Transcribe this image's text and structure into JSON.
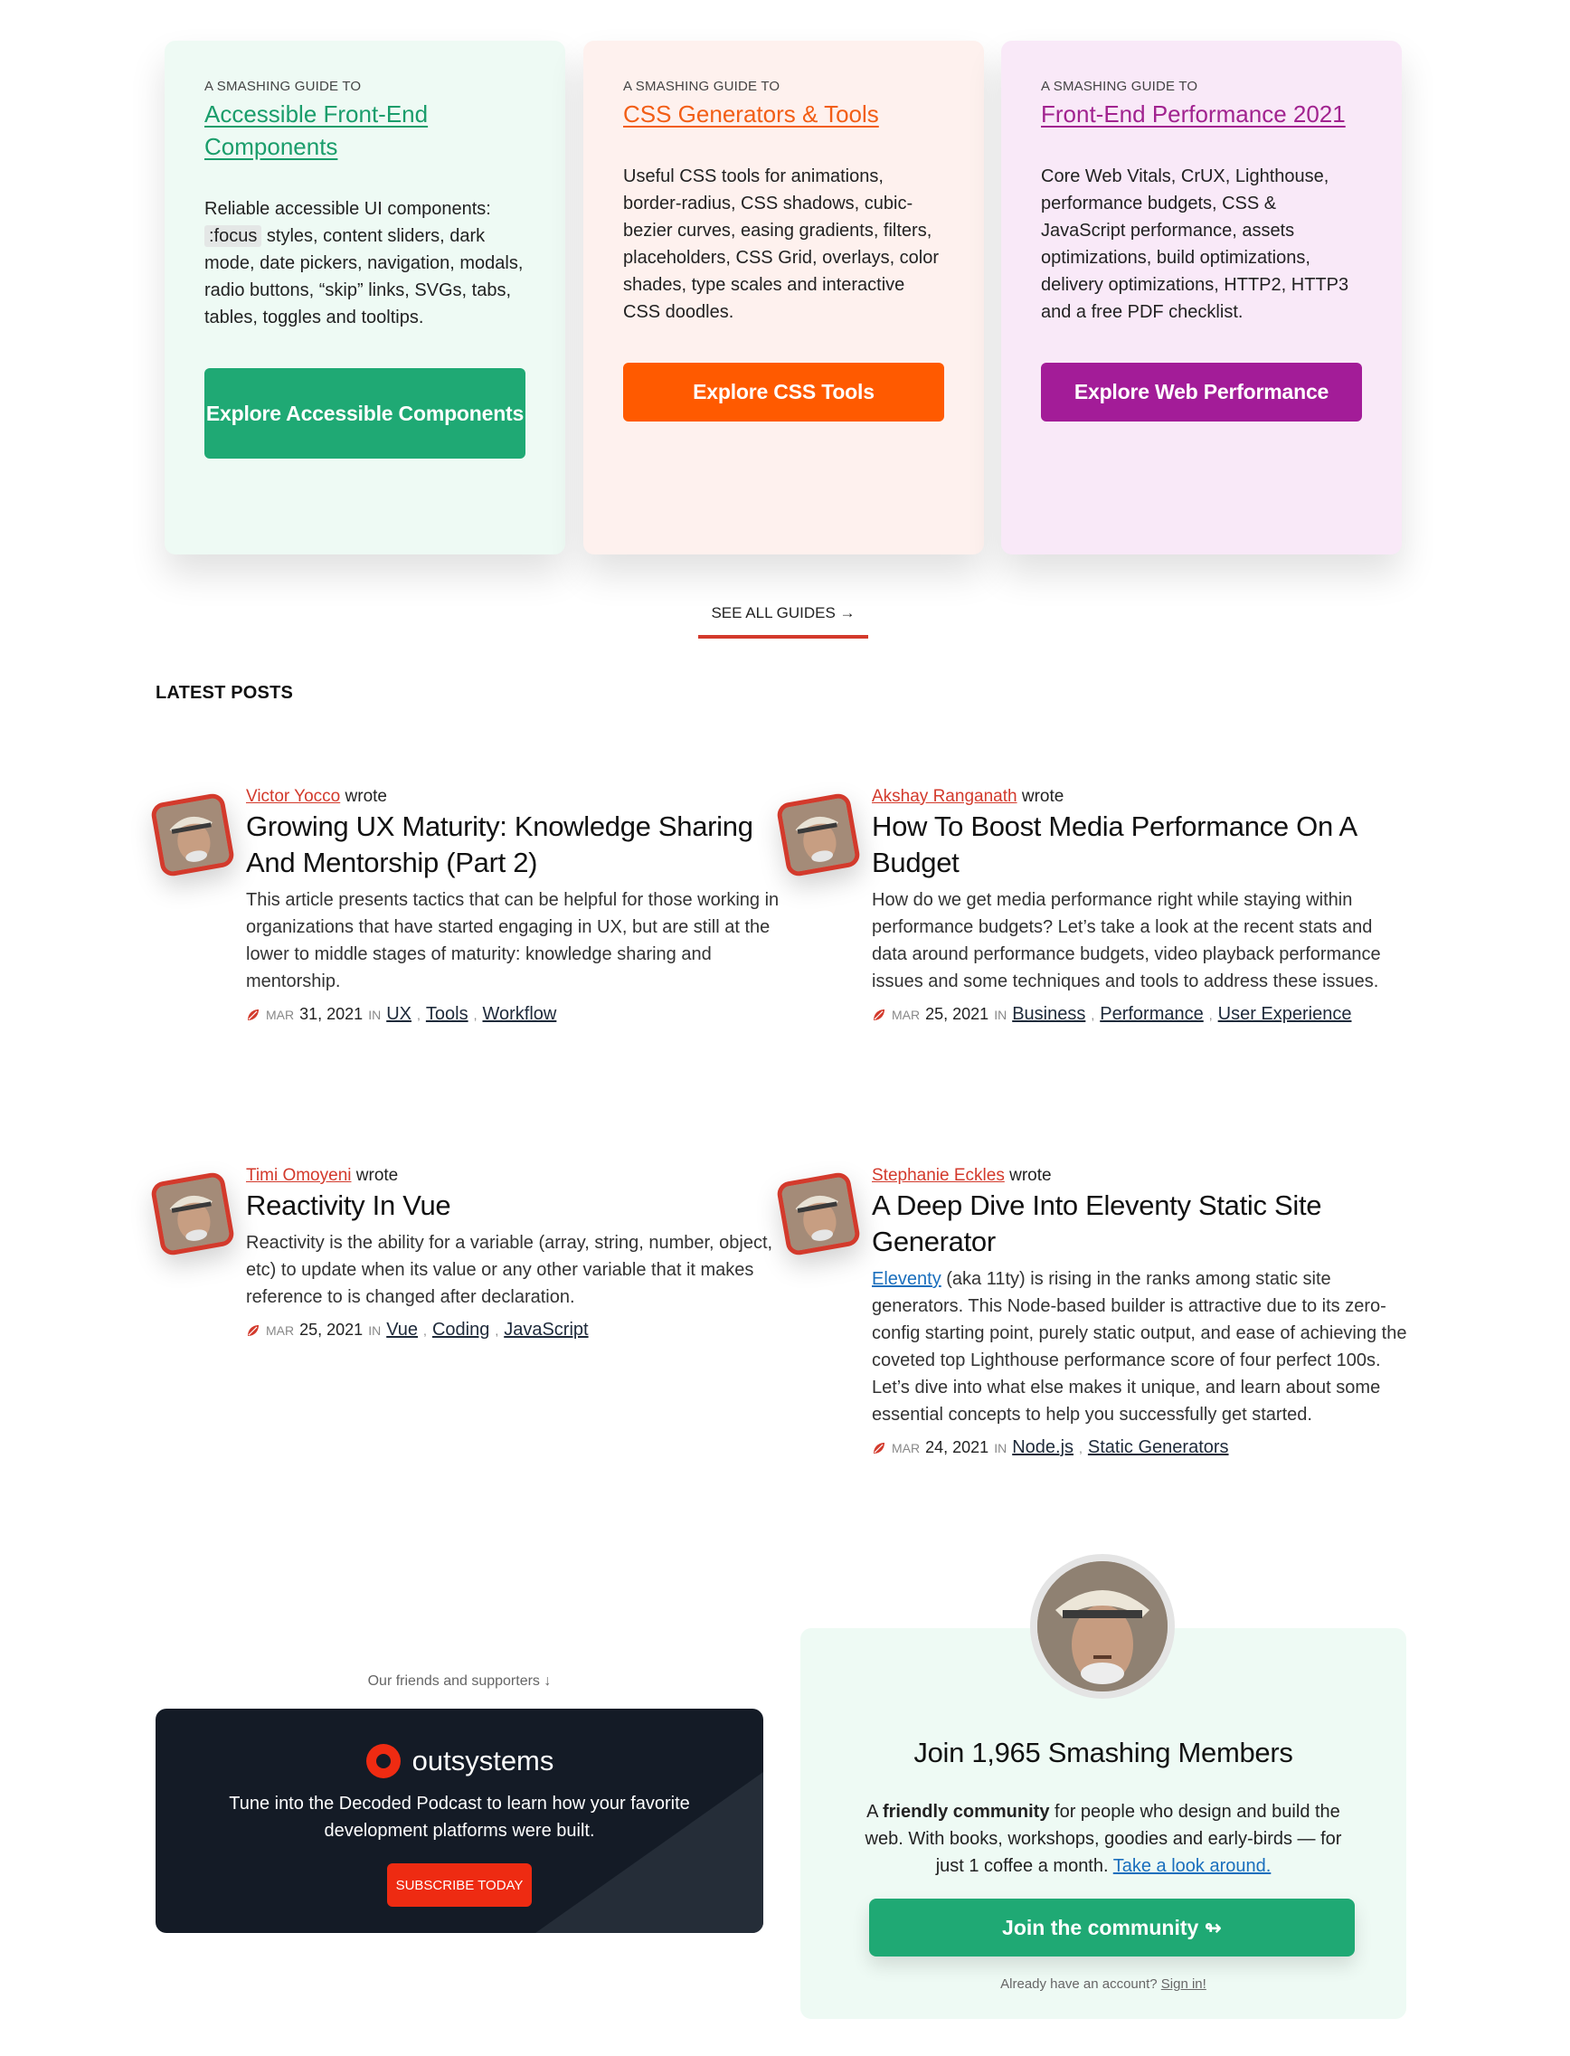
{
  "guides": [
    {
      "kicker": "A Smashing Guide to",
      "title": "Accessible Front-End Components",
      "desc_parts": [
        "Reliable accessible UI components: ",
        ":focus",
        " styles, content sliders, dark mode, date pickers, navigation, modals, radio buttons, “skip” links, SVGs, tabs, tables, toggles and tooltips."
      ],
      "button": "Explore Accessible Components",
      "color": "#1fa974"
    },
    {
      "kicker": "A Smashing Guide to",
      "title": "CSS Generators & Tools",
      "desc": "Useful CSS tools for animations, border-radius, CSS shadows, cubic-bezier curves, easing gradients, filters, placeholders, CSS Grid, overlays, color shades, type scales and interactive CSS doodles.",
      "button": "Explore CSS Tools",
      "color": "#ff5a00"
    },
    {
      "kicker": "A Smashing Guide to",
      "title": "Front-End Performance 2021",
      "desc": "Core Web Vitals, CrUX, Lighthouse, performance budgets, CSS & JavaScript performance, assets optimizations, build optimizations, delivery optimizations, HTTP2, HTTP3 and a free PDF checklist.",
      "button": "Explore Web Performance",
      "color": "#a31c98"
    }
  ],
  "see_all": "See all guides →",
  "latest_title": "Latest Posts",
  "posts": [
    {
      "author": "Victor Yocco",
      "wrote": "wrote",
      "title": "Growing UX Maturity: Knowledge Sharing And Mentorship (Part 2)",
      "excerpt": "This article presents tactics that can be helpful for those working in organizations that have started engaging in UX, but are still at the lower to middle stages of maturity: knowledge sharing and mentorship.",
      "month": "Mar",
      "date": "31, 2021",
      "in": "in",
      "tags": [
        "UX",
        "Tools",
        "Workflow"
      ]
    },
    {
      "author": "Akshay Ranganath",
      "wrote": "wrote",
      "title": "How To Boost Media Performance On A Budget",
      "excerpt": "How do we get media performance right while staying within performance budgets? Let’s take a look at the recent stats and data around performance budgets, video playback performance issues and some techniques and tools to address these issues.",
      "month": "Mar",
      "date": "25, 2021",
      "in": "in",
      "tags": [
        "Business",
        "Performance",
        "User Experience"
      ]
    },
    {
      "author": "Timi Omoyeni",
      "wrote": "wrote",
      "title": "Reactivity In Vue",
      "excerpt": "Reactivity is the ability for a variable (array, string, number, object, etc) to update when its value or any other variable that it makes reference to is changed after declaration.",
      "month": "Mar",
      "date": "25, 2021",
      "in": "in",
      "tags": [
        "Vue",
        "Coding",
        "JavaScript"
      ]
    },
    {
      "author": "Stephanie Eckles",
      "wrote": "wrote",
      "title": "A Deep Dive Into Eleventy Static Site Generator",
      "excerpt_link": "Eleventy",
      "excerpt": " (aka 11ty) is rising in the ranks among static site generators. This Node-based builder is attractive due to its zero-config starting point, purely static output, and ease of achieving the coveted top Lighthouse performance score of four perfect 100s. Let’s dive into what else makes it unique, and learn about some essential concepts to help you successfully get started.",
      "month": "Mar",
      "date": "24, 2021",
      "in": "in",
      "tags": [
        "Node.js",
        "Static Generators"
      ]
    }
  ],
  "supporters": {
    "label": "Our friends and supporters ↓",
    "logo_text": "outsystems",
    "text": "Tune into the Decoded Podcast to learn how your favorite development platforms were built.",
    "button": "Subscribe today"
  },
  "members": {
    "title": "Join 1,965 Smashing Members",
    "text_a": "A ",
    "text_bold": "friendly community",
    "text_b": " for people who design and build the web. With books, workshops, goodies and early-birds — for just 1 coffee a month. ",
    "text_link": "Take a look around.",
    "button": "Join the community ↬",
    "signin_text": "Already have an account? ",
    "signin_link": "Sign in!"
  },
  "colors": {
    "accent_red": "#d33a2c",
    "green": "#1fa974",
    "orange": "#ff5a00",
    "purple": "#a31c98"
  }
}
